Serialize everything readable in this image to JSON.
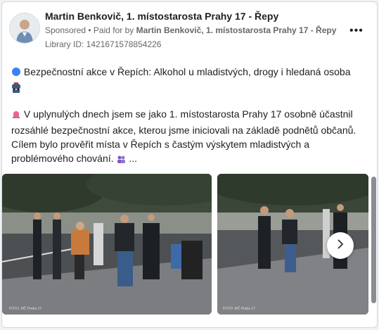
{
  "post": {
    "author": "Martin Benkovič, 1. místostarosta Prahy 17 - Řepy",
    "sponsored": "Sponsored",
    "separator": " • ",
    "paid_for_prefix": "Paid for by ",
    "paid_for_name": "Martin Benkovič, 1. místostarosta Prahy 17 - Řepy",
    "library_id": "Library ID: 1421671578854226",
    "more_label": "•••",
    "line1_icon": "blue-circle",
    "line1": "Bezpečnostní akce v Řepích: Alkohol u mladistvých, drogy i hledaná osoba",
    "line1_trailing_icons": [
      "police-officer",
      "police-car"
    ],
    "para_icon": "siren",
    "paragraph": "V uplynulých dnech jsem se jako 1. místostarosta Prahy 17 osobně účastnil rozsáhlé bezpečnostní akce, kterou jsme iniciovali na základě podnětů občanů. Cílem bylo prověřit místa v Řepích s častým výskytem mladistvých a problémového chování.",
    "para_end_icon": "people",
    "ellipsis": "..."
  },
  "photos": [
    {
      "caption": "FOTO: MČ Praha 17"
    },
    {
      "caption": "FOTO: MČ Praha 17"
    }
  ],
  "carousel": {
    "next_icon": "chevron-right-icon"
  },
  "colors": {
    "text": "#1c1e21",
    "muted": "#65676b"
  }
}
